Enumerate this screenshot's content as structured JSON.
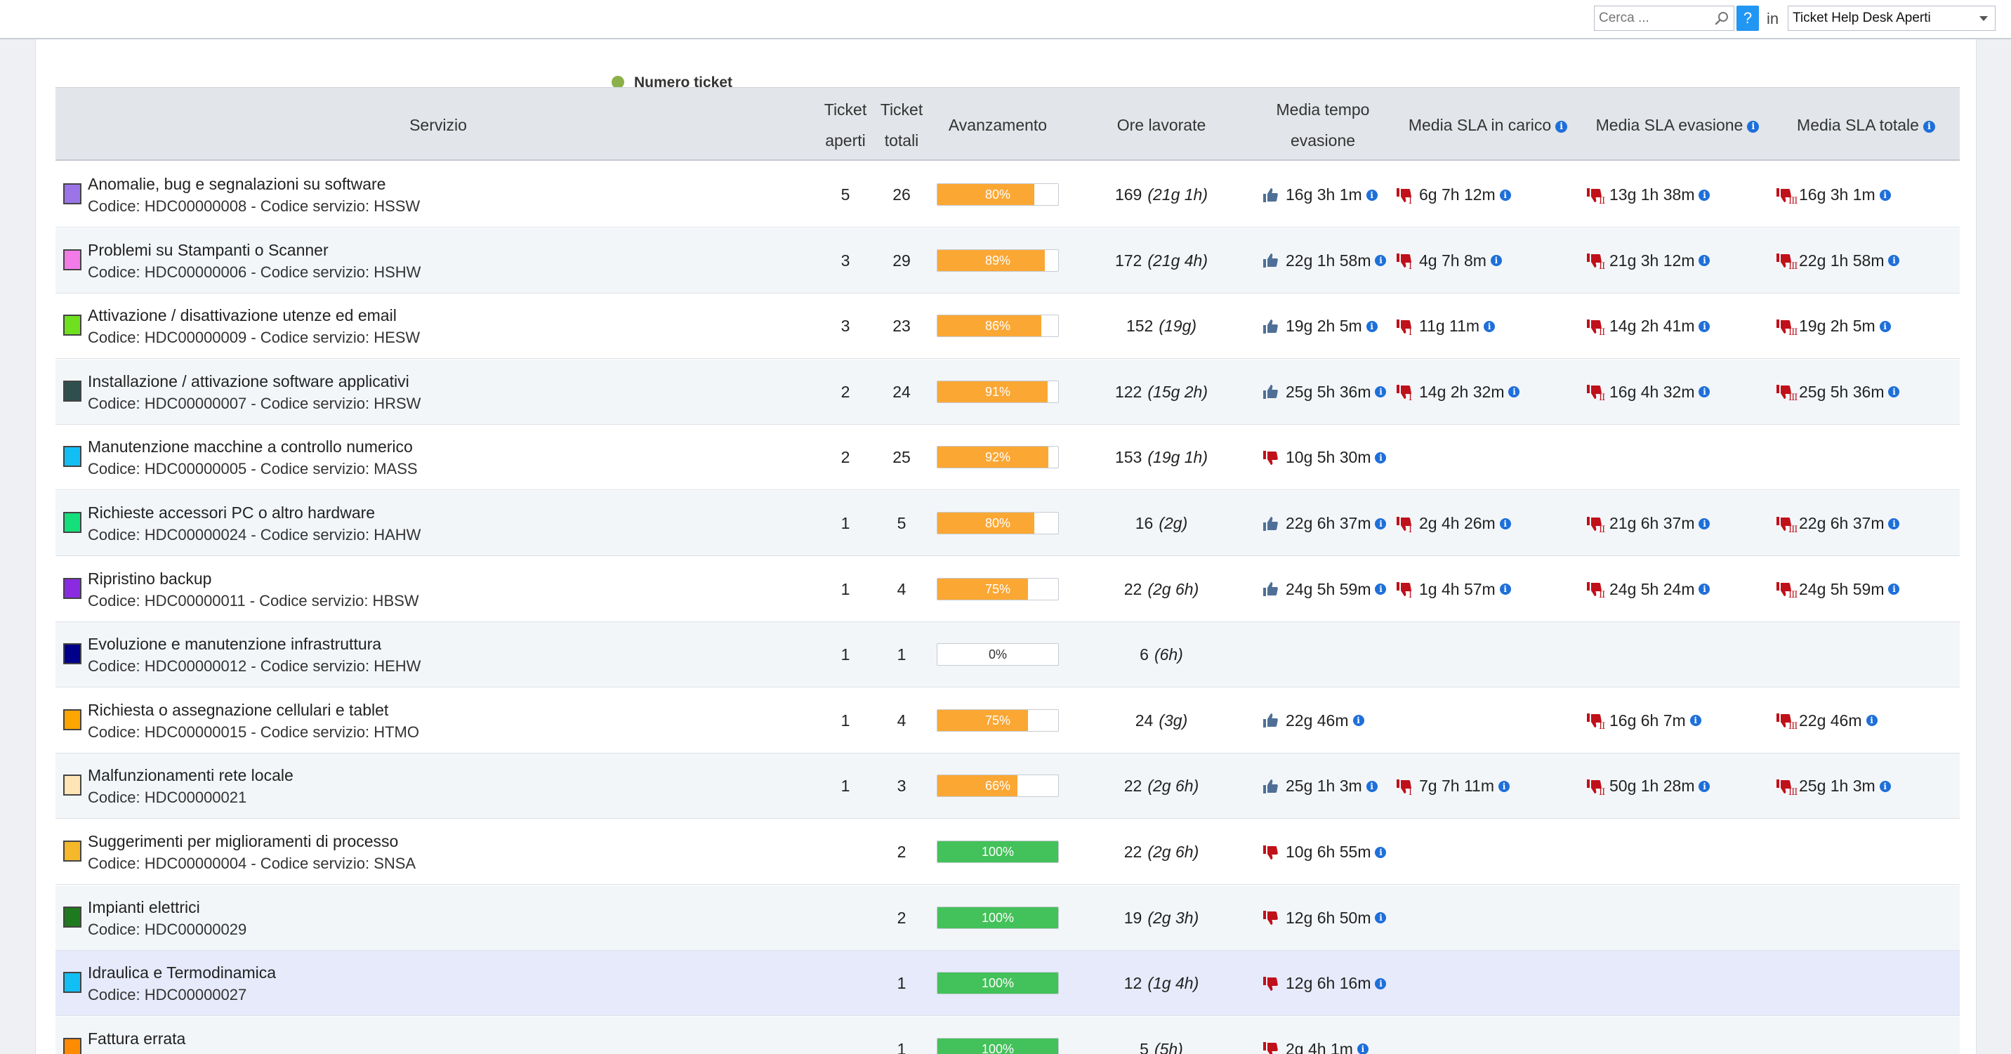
{
  "topbar": {
    "search_placeholder": "Cerca ...",
    "help_label": "?",
    "in_label": "in",
    "selected_view": "Ticket Help Desk Aperti"
  },
  "legend": {
    "label": "Numero ticket",
    "color": "#8bb04a"
  },
  "columns": {
    "servizio": "Servizio",
    "ticket_aperti_1": "Ticket",
    "ticket_aperti_2": "aperti",
    "ticket_totali_1": "Ticket",
    "ticket_totali_2": "totali",
    "avanzamento": "Avanzamento",
    "ore_lavorate": "Ore lavorate",
    "media_tempo_1": "Media tempo",
    "media_tempo_2": "evasione",
    "sla_carico": "Media SLA in carico",
    "sla_evasione": "Media SLA evasione",
    "sla_totale": "Media SLA totale"
  },
  "rows": [
    {
      "name": "Anomalie, bug e segnalazioni su software",
      "code": "Codice: HDC00000008 - Codice servizio: HSSW",
      "color": "#9b74e8",
      "aperti": "5",
      "totali": "26",
      "progress": 80,
      "progress_label": "80%",
      "ore": "169",
      "ore_sub": "(21g 1h)",
      "media": {
        "v": "16g 3h 1m",
        "ok": true
      },
      "carico": {
        "v": "6g 7h 12m",
        "ok": false,
        "lvl": "I"
      },
      "evasione": {
        "v": "13g 1h 38m",
        "ok": false,
        "lvl": "II"
      },
      "totale": {
        "v": "16g 3h 1m",
        "ok": false,
        "lvl": "III"
      }
    },
    {
      "name": "Problemi su Stampanti o Scanner",
      "code": "Codice: HDC00000006 - Codice servizio: HSHW",
      "color": "#f27be8",
      "aperti": "3",
      "totali": "29",
      "progress": 89,
      "progress_label": "89%",
      "ore": "172",
      "ore_sub": "(21g 4h)",
      "media": {
        "v": "22g 1h 58m",
        "ok": true
      },
      "carico": {
        "v": "4g 7h 8m",
        "ok": false,
        "lvl": "I"
      },
      "evasione": {
        "v": "21g 3h 12m",
        "ok": false,
        "lvl": "II"
      },
      "totale": {
        "v": "22g 1h 58m",
        "ok": false,
        "lvl": "III"
      }
    },
    {
      "name": "Attivazione / disattivazione utenze ed email",
      "code": "Codice: HDC00000009 - Codice servizio: HESW",
      "color": "#6fe01e",
      "aperti": "3",
      "totali": "23",
      "progress": 86,
      "progress_label": "86%",
      "ore": "152",
      "ore_sub": "(19g)",
      "media": {
        "v": "19g 2h 5m",
        "ok": true
      },
      "carico": {
        "v": "11g 11m",
        "ok": false,
        "lvl": "I"
      },
      "evasione": {
        "v": "14g 2h 41m",
        "ok": false,
        "lvl": "II"
      },
      "totale": {
        "v": "19g 2h 5m",
        "ok": false,
        "lvl": "III"
      }
    },
    {
      "name": "Installazione / attivazione software applicativi",
      "code": "Codice: HDC00000007 - Codice servizio: HRSW",
      "color": "#2f4f4f",
      "aperti": "2",
      "totali": "24",
      "progress": 91,
      "progress_label": "91%",
      "ore": "122",
      "ore_sub": "(15g 2h)",
      "media": {
        "v": "25g 5h 36m",
        "ok": true
      },
      "carico": {
        "v": "14g 2h 32m",
        "ok": false,
        "lvl": "I"
      },
      "evasione": {
        "v": "16g 4h 32m",
        "ok": false,
        "lvl": "II"
      },
      "totale": {
        "v": "25g 5h 36m",
        "ok": false,
        "lvl": "III"
      }
    },
    {
      "name": "Manutenzione macchine a controllo numerico",
      "code": "Codice: HDC00000005 - Codice servizio: MASS",
      "color": "#11bff5",
      "aperti": "2",
      "totali": "25",
      "progress": 92,
      "progress_label": "92%",
      "ore": "153",
      "ore_sub": "(19g 1h)",
      "media": {
        "v": "10g 5h 30m",
        "ok": false
      },
      "carico": null,
      "evasione": null,
      "totale": null
    },
    {
      "name": "Richieste accessori PC o altro hardware",
      "code": "Codice: HDC00000024 - Codice servizio: HAHW",
      "color": "#13e07a",
      "aperti": "1",
      "totali": "5",
      "progress": 80,
      "progress_label": "80%",
      "ore": "16",
      "ore_sub": "(2g)",
      "media": {
        "v": "22g 6h 37m",
        "ok": true
      },
      "carico": {
        "v": "2g 4h 26m",
        "ok": false,
        "lvl": "I"
      },
      "evasione": {
        "v": "21g 6h 37m",
        "ok": false,
        "lvl": "II"
      },
      "totale": {
        "v": "22g 6h 37m",
        "ok": false,
        "lvl": "III"
      }
    },
    {
      "name": "Ripristino backup",
      "code": "Codice: HDC00000011 - Codice servizio: HBSW",
      "color": "#8a2be2",
      "aperti": "1",
      "totali": "4",
      "progress": 75,
      "progress_label": "75%",
      "ore": "22",
      "ore_sub": "(2g 6h)",
      "media": {
        "v": "24g 5h 59m",
        "ok": true
      },
      "carico": {
        "v": "1g 4h 57m",
        "ok": false,
        "lvl": "I"
      },
      "evasione": {
        "v": "24g 5h 24m",
        "ok": false,
        "lvl": "II"
      },
      "totale": {
        "v": "24g 5h 59m",
        "ok": false,
        "lvl": "III"
      }
    },
    {
      "name": "Evoluzione e manutenzione infrastruttura",
      "code": "Codice: HDC00000012 - Codice servizio: HEHW",
      "color": "#00008b",
      "aperti": "1",
      "totali": "1",
      "progress": 0,
      "progress_label": "0%",
      "ore": "6",
      "ore_sub": "(6h)",
      "media": null,
      "carico": null,
      "evasione": null,
      "totale": null
    },
    {
      "name": "Richiesta o assegnazione cellulari e tablet",
      "code": "Codice: HDC00000015 - Codice servizio: HTMO",
      "color": "#ffa500",
      "aperti": "1",
      "totali": "4",
      "progress": 75,
      "progress_label": "75%",
      "ore": "24",
      "ore_sub": "(3g)",
      "media": {
        "v": "22g 46m",
        "ok": true
      },
      "carico": null,
      "evasione": {
        "v": "16g 6h 7m",
        "ok": false,
        "lvl": "II"
      },
      "totale": {
        "v": "22g 46m",
        "ok": false,
        "lvl": "III"
      }
    },
    {
      "name": "Malfunzionamenti rete locale",
      "code": "Codice: HDC00000021",
      "color": "#ffe4b5",
      "aperti": "1",
      "totali": "3",
      "progress": 66,
      "progress_label": "66%",
      "ore": "22",
      "ore_sub": "(2g 6h)",
      "media": {
        "v": "25g 1h 3m",
        "ok": true
      },
      "carico": {
        "v": "7g 7h 11m",
        "ok": false,
        "lvl": "I"
      },
      "evasione": {
        "v": "50g 1h 28m",
        "ok": false,
        "lvl": "II"
      },
      "totale": {
        "v": "25g 1h 3m",
        "ok": false,
        "lvl": "III"
      }
    },
    {
      "name": "Suggerimenti per miglioramenti di processo",
      "code": "Codice: HDC00000004 - Codice servizio: SNSA",
      "color": "#f5b82a",
      "aperti": "",
      "totali": "2",
      "progress": 100,
      "progress_label": "100%",
      "ore": "22",
      "ore_sub": "(2g 6h)",
      "media": {
        "v": "10g 6h 55m",
        "ok": false
      },
      "carico": null,
      "evasione": null,
      "totale": null
    },
    {
      "name": "Impianti elettrici",
      "code": "Codice: HDC00000029",
      "color": "#1e7a1e",
      "aperti": "",
      "totali": "2",
      "progress": 100,
      "progress_label": "100%",
      "ore": "19",
      "ore_sub": "(2g 3h)",
      "media": {
        "v": "12g 6h 50m",
        "ok": false
      },
      "carico": null,
      "evasione": null,
      "totale": null
    },
    {
      "name": "Idraulica e Termodinamica",
      "code": "Codice: HDC00000027",
      "color": "#11bff5",
      "aperti": "",
      "totali": "1",
      "progress": 100,
      "progress_label": "100%",
      "ore": "12",
      "ore_sub": "(1g 4h)",
      "media": {
        "v": "12g 6h 16m",
        "ok": false
      },
      "carico": null,
      "evasione": null,
      "totale": null
    },
    {
      "name": "Fattura errata",
      "code": "",
      "color": "#ff8c00",
      "aperti": "",
      "totali": "1",
      "progress": 100,
      "progress_label": "100%",
      "ore": "5",
      "ore_sub": "(5h)",
      "media": {
        "v": "2g 4h 1m",
        "ok": false
      },
      "carico": null,
      "evasione": null,
      "totale": null
    }
  ]
}
